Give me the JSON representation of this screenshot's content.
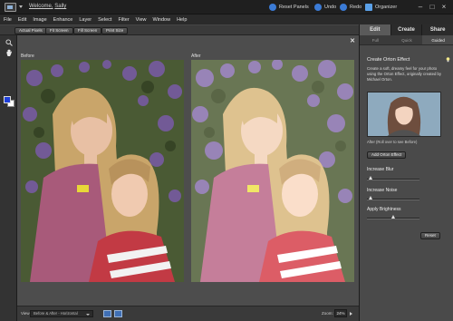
{
  "titlebar": {
    "welcome_prefix": "Welcome,",
    "user_name": "Sally",
    "reset_panels": "Reset Panels",
    "undo": "Undo",
    "redo": "Redo",
    "organizer": "Organizer"
  },
  "menu": [
    "File",
    "Edit",
    "Image",
    "Enhance",
    "Layer",
    "Select",
    "Filter",
    "View",
    "Window",
    "Help"
  ],
  "options_bar": {
    "buttons": [
      "Actual Pixels",
      "Fit Screen",
      "Fill Screen",
      "Print Size"
    ]
  },
  "toolbox": {
    "tools": [
      "zoom-icon",
      "hand-icon"
    ],
    "foreground_color": "#1f3fd8",
    "background_color": "#ffffff"
  },
  "workarea": {
    "before_label": "Before",
    "after_label": "After"
  },
  "statusbar": {
    "view_label": "View:",
    "view_value": "Before & After - Horizontal",
    "zoom_label": "Zoom:",
    "zoom_value": "24%"
  },
  "panel": {
    "mode_tabs": [
      "Edit",
      "Create",
      "Share"
    ],
    "active_mode": "Edit",
    "sub_tabs": [
      "Full",
      "Quick",
      "Guided"
    ],
    "active_sub_tab": "Guided",
    "effect_title": "Create Orton Effect",
    "effect_description": "Create a soft, dreamy feel for your photo using the Orton Effect, originally created by Michael Orton.",
    "thumb_caption": "After (Roll over to see Before)",
    "add_button": "Add Orton Effect",
    "sliders": [
      {
        "label": "Increase Blur",
        "level": 0.08
      },
      {
        "label": "Increase Noise",
        "level": 0.08
      },
      {
        "label": "Apply Brightness",
        "level": 0.5
      }
    ],
    "reset_button": "Reset"
  }
}
